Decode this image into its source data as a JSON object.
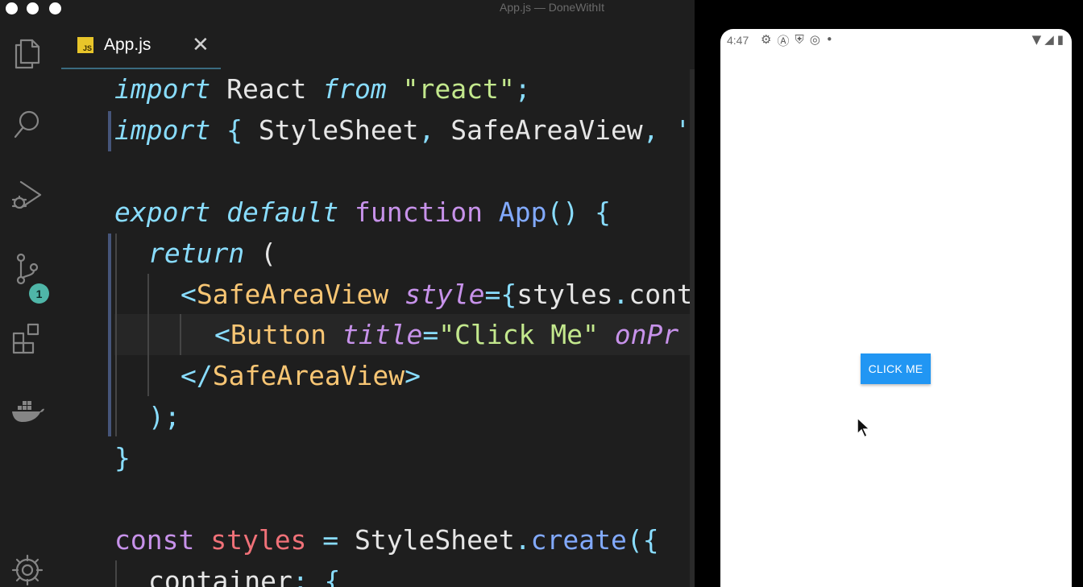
{
  "window": {
    "title": "App.js — DoneWithIt"
  },
  "activity_bar": {
    "items": [
      {
        "icon": "files-icon"
      },
      {
        "icon": "search-icon"
      },
      {
        "icon": "run-debug-icon"
      },
      {
        "icon": "source-control-icon",
        "badge": "1"
      },
      {
        "icon": "extensions-icon"
      },
      {
        "icon": "docker-icon"
      },
      {
        "icon": "settings-gear-icon"
      }
    ]
  },
  "tab": {
    "label": "App.js",
    "badge": "JS",
    "close": "✕"
  },
  "code": {
    "line1": {
      "a": "import",
      "b": " React ",
      "c": "from",
      "d": " ",
      "e": "\"react\"",
      "f": ";"
    },
    "line2": {
      "a": "import",
      "b": " { ",
      "c": "StyleSheet",
      "d": ", ",
      "e": "SafeAreaView",
      "f": ", '"
    },
    "line3": {
      "a": "export",
      "b": " ",
      "c": "default",
      "d": " ",
      "e": "function",
      "f": " ",
      "g": "App",
      "h": "() {"
    },
    "line4": {
      "a": "return",
      "b": " ("
    },
    "line5": {
      "a": "<",
      "b": "SafeAreaView",
      "c": " ",
      "d": "style",
      "e": "={",
      "f": "styles",
      "g": ".",
      "h": "cont"
    },
    "line6": {
      "a": "<",
      "b": "Button",
      "c": " ",
      "d": "title",
      "e": "=",
      "f": "\"Click Me\"",
      "g": " ",
      "h": "onPr"
    },
    "line7": {
      "a": "</",
      "b": "SafeAreaView",
      "c": ">"
    },
    "line8": {
      "a": ");"
    },
    "line9": {
      "a": "}"
    },
    "line10": {
      "a": "const",
      "b": " ",
      "c": "styles",
      "d": " = ",
      "e": "StyleSheet",
      "f": ".",
      "g": "create",
      "h": "({"
    },
    "line11": {
      "a": "container",
      "b": ": {"
    }
  },
  "phone": {
    "time": "4:47",
    "status_icons": [
      "⚙",
      "Ⓐ",
      "⛨",
      "◎",
      "•"
    ],
    "status_right": [
      "▼",
      "◢",
      "▮"
    ],
    "button_label": "CLICK ME"
  },
  "colors": {
    "keyword": "#89ddff",
    "string": "#c3e88d",
    "tag": "#f8c674",
    "function": "#82aaff",
    "accent_button": "#2196f3"
  }
}
